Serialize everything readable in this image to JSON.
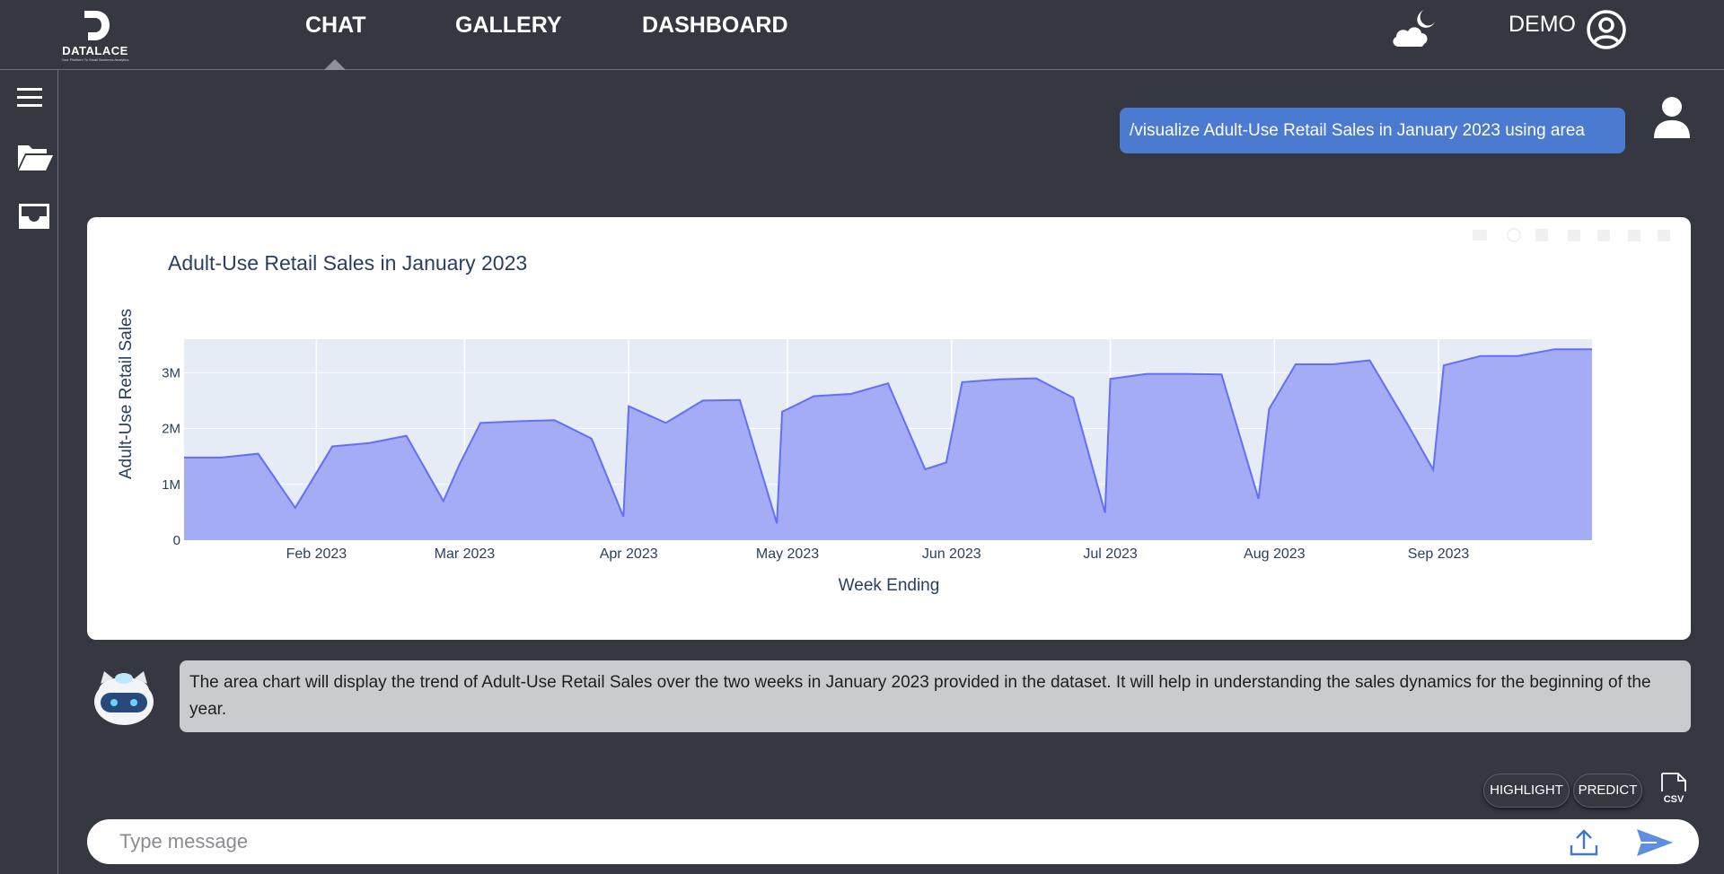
{
  "brand": {
    "name": "DATALACE",
    "tagline": "Your Platform To Small Business Analytics"
  },
  "nav": {
    "tabs": [
      {
        "label": "CHAT"
      },
      {
        "label": "GALLERY"
      },
      {
        "label": "DASHBOARD"
      }
    ],
    "active": "CHAT"
  },
  "user": {
    "name": "DEMO"
  },
  "chat": {
    "user_message": "/visualize Adult-Use Retail Sales in January 2023 using area",
    "bot_message": "The area chart will display the trend of Adult-Use Retail Sales over the two weeks in January 2023 provided in the dataset. It will help in understanding the sales dynamics for the beginning of the year.",
    "input_placeholder": "Type message",
    "actions": {
      "highlight_label": "HIGHLIGHT",
      "predict_label": "PREDICT",
      "csv_label": "CSV"
    }
  },
  "colors": {
    "accent": "#4a7bd1",
    "area_fill": "#a3acf5",
    "area_line": "#636efa",
    "plot_bg": "#e5ecf6"
  },
  "chart_data": {
    "type": "area",
    "title": "Adult-Use Retail Sales in January 2023",
    "xlabel": "Week Ending",
    "ylabel": "Adult-Use Retail Sales",
    "yticks": [
      {
        "value": 0,
        "label": "0"
      },
      {
        "value": 1000000,
        "label": "1M"
      },
      {
        "value": 2000000,
        "label": "2M"
      },
      {
        "value": 3000000,
        "label": "3M"
      }
    ],
    "ylim": [
      0,
      3600000
    ],
    "xlim": [
      "2023-01-07",
      "2023-09-30"
    ],
    "xticks": [
      {
        "date": "2023-02-01",
        "label": "Feb 2023"
      },
      {
        "date": "2023-03-01",
        "label": "Mar 2023"
      },
      {
        "date": "2023-04-01",
        "label": "Apr 2023"
      },
      {
        "date": "2023-05-01",
        "label": "May 2023"
      },
      {
        "date": "2023-06-01",
        "label": "Jun 2023"
      },
      {
        "date": "2023-07-01",
        "label": "Jul 2023"
      },
      {
        "date": "2023-08-01",
        "label": "Aug 2023"
      },
      {
        "date": "2023-09-01",
        "label": "Sep 2023"
      }
    ],
    "grid": true,
    "x": [
      "2023-01-07",
      "2023-01-14",
      "2023-01-21",
      "2023-01-28",
      "2023-01-31",
      "2023-02-04",
      "2023-02-11",
      "2023-02-18",
      "2023-02-25",
      "2023-02-28",
      "2023-03-04",
      "2023-03-11",
      "2023-03-18",
      "2023-03-25",
      "2023-03-31",
      "2023-04-01",
      "2023-04-08",
      "2023-04-15",
      "2023-04-22",
      "2023-04-29",
      "2023-04-30",
      "2023-05-06",
      "2023-05-13",
      "2023-05-20",
      "2023-05-27",
      "2023-05-31",
      "2023-06-03",
      "2023-06-10",
      "2023-06-17",
      "2023-06-24",
      "2023-06-30",
      "2023-07-01",
      "2023-07-08",
      "2023-07-15",
      "2023-07-22",
      "2023-07-29",
      "2023-07-31",
      "2023-08-05",
      "2023-08-12",
      "2023-08-19",
      "2023-08-26",
      "2023-08-31",
      "2023-09-02",
      "2023-09-09",
      "2023-09-16",
      "2023-09-23",
      "2023-09-30"
    ],
    "series": [
      {
        "values": [
          1480000,
          1480000,
          1550000,
          580000,
          1050000,
          1680000,
          1740000,
          1870000,
          700000,
          1350000,
          2100000,
          2130000,
          2150000,
          1820000,
          420000,
          2400000,
          2100000,
          2500000,
          2510000,
          300000,
          2300000,
          2580000,
          2620000,
          2810000,
          1270000,
          1390000,
          2830000,
          2880000,
          2900000,
          2550000,
          490000,
          2890000,
          2980000,
          2980000,
          2970000,
          740000,
          2350000,
          3150000,
          3150000,
          3220000,
          2100000,
          1260000,
          3130000,
          3300000,
          3300000,
          3420000,
          3420000
        ]
      }
    ]
  }
}
